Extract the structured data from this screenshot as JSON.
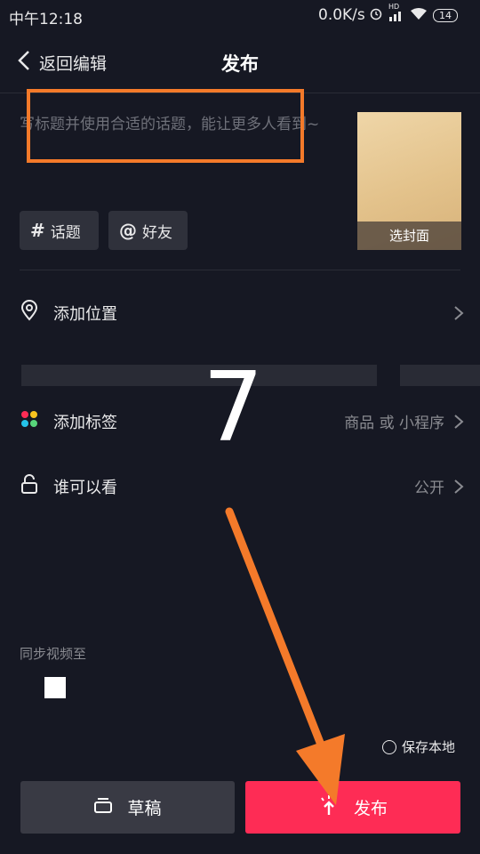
{
  "status_bar": {
    "time": "中午12:18",
    "network_speed": "0.0K/s",
    "hd_label": "HD",
    "battery": "14"
  },
  "header": {
    "back_label": "返回编辑",
    "title": "发布"
  },
  "caption": {
    "placeholder": "写标题并使用合适的话题，能让更多人看到~"
  },
  "cover": {
    "label": "选封面"
  },
  "chips": {
    "topic_icon": "#",
    "topic_label": "话题",
    "friend_icon": "@",
    "friend_label": "好友"
  },
  "rows": {
    "location_label": "添加位置",
    "tag_label": "添加标签",
    "tag_value": "商品 或 小程序",
    "visibility_label": "谁可以看",
    "visibility_value": "公开"
  },
  "overlay_step": "7",
  "sync": {
    "label": "同步视频至"
  },
  "save_local": {
    "label": "保存本地"
  },
  "buttons": {
    "draft_label": "草稿",
    "publish_label": "发布"
  },
  "colors": {
    "accent": "#fe2c55",
    "annotation": "#f47a2a",
    "background": "#161823"
  },
  "icons": [
    "chevron-left-icon",
    "location-pin-icon",
    "tag-dots-icon",
    "lock-icon",
    "chevron-right-icon",
    "draft-icon",
    "publish-spark-icon"
  ]
}
